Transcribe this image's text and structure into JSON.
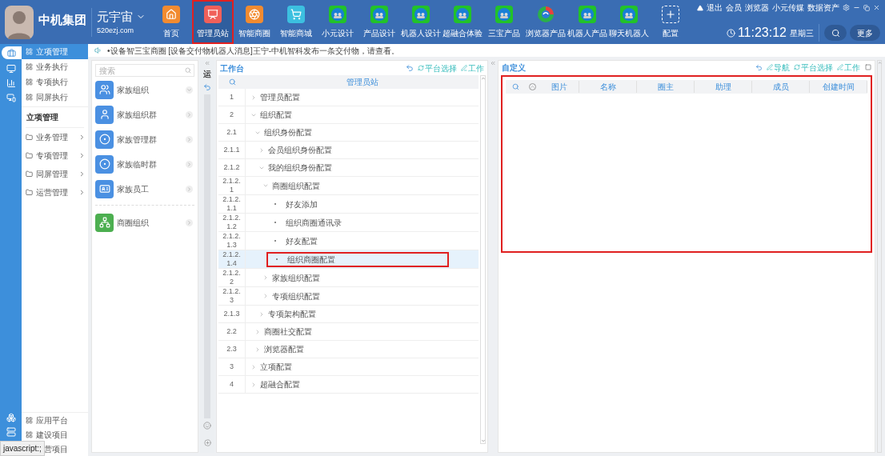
{
  "brand": {
    "name": "中机集团",
    "product": "元宇宙",
    "domain": "520ezj.com"
  },
  "nav": [
    {
      "label": "首页",
      "kind": "home",
      "selected": false
    },
    {
      "label": "管理员站",
      "kind": "admin",
      "selected": true
    },
    {
      "label": "智能商圈",
      "kind": "aperture",
      "selected": false
    },
    {
      "label": "智能商城",
      "kind": "cart",
      "selected": false
    },
    {
      "label": "小元设计",
      "kind": "globe",
      "selected": false
    },
    {
      "label": "产品设计",
      "kind": "globe",
      "selected": false
    },
    {
      "label": "机器人设计",
      "kind": "globe",
      "selected": false
    },
    {
      "label": "超融合体验",
      "kind": "globe",
      "selected": false
    },
    {
      "label": "三宝产品",
      "kind": "globe",
      "selected": false
    },
    {
      "label": "浏览器产品",
      "kind": "swirl",
      "selected": false
    },
    {
      "label": "机器人产品",
      "kind": "globe",
      "selected": false
    },
    {
      "label": "聊天机器人",
      "kind": "globe",
      "selected": false
    },
    {
      "label": "配置",
      "kind": "plus",
      "selected": false
    }
  ],
  "top_links": [
    "退出",
    "会员",
    "浏览器",
    "小元传媒",
    "数据资产"
  ],
  "clock": {
    "time": "11:23:12",
    "weekday": "星期三"
  },
  "more_button": "更多",
  "notice": "•设备智三宝商圈 [设备交付物机器人消息]王宁-中机智科发布一条交付物，请查看。",
  "sidebar": {
    "top_items": [
      {
        "label": "立项管理",
        "selected": true
      },
      {
        "label": "业务执行",
        "selected": false
      },
      {
        "label": "专项执行",
        "selected": false
      },
      {
        "label": "同屏执行",
        "selected": false
      }
    ],
    "heading": "立项管理",
    "groups": [
      "业务管理",
      "专项管理",
      "同屏管理",
      "运营管理"
    ],
    "bottom_items": [
      {
        "label": "应用平台",
        "covered": false
      },
      {
        "label": "建设项目",
        "covered": false
      },
      {
        "label": "营项目",
        "covered": true
      }
    ]
  },
  "org_list": {
    "search_placeholder": "搜索",
    "items": [
      {
        "label": "家族组织",
        "color": "#4a90e2",
        "expanded": true,
        "kind": "group"
      },
      {
        "label": "家族组织群",
        "color": "#4a90e2",
        "expanded": false,
        "kind": "user"
      },
      {
        "label": "家族管理群",
        "color": "#4a90e2",
        "expanded": false,
        "kind": "ring"
      },
      {
        "label": "家族临时群",
        "color": "#4a90e2",
        "expanded": false,
        "kind": "ring"
      },
      {
        "label": "家族员工",
        "color": "#4a90e2",
        "expanded": false,
        "kind": "badge"
      },
      {
        "label": "商圈组织",
        "color": "#4caf50",
        "expanded": false,
        "kind": "tree"
      }
    ]
  },
  "side_tab": "运",
  "workbench": {
    "title": "工作台",
    "actions": [
      "平台选择",
      "工作"
    ],
    "column": "管理员站",
    "tree": [
      {
        "number": "1",
        "label": "管理员配置",
        "kind": "branch",
        "expanded": false,
        "selected": false
      },
      {
        "number": "2",
        "label": "组织配置",
        "kind": "branch",
        "expanded": true,
        "selected": false,
        "children": [
          {
            "number": "2.1",
            "label": "组织身份配置",
            "kind": "branch",
            "expanded": true,
            "selected": false,
            "children": [
              {
                "number": "2.1.1",
                "label": "会员组织身份配置",
                "kind": "branch",
                "expanded": false,
                "selected": false
              },
              {
                "number": "2.1.2",
                "label": "我的组织身份配置",
                "kind": "branch",
                "expanded": true,
                "selected": false,
                "children": [
                  {
                    "number": "2.1.2.1",
                    "label": "商圈组织配置",
                    "kind": "branch",
                    "expanded": true,
                    "selected": false,
                    "children": [
                      {
                        "number": "2.1.2.1.1",
                        "label": "好友添加",
                        "kind": "leaf",
                        "selected": false
                      },
                      {
                        "number": "2.1.2.1.2",
                        "label": "组织商圈通讯录",
                        "kind": "leaf",
                        "selected": false
                      },
                      {
                        "number": "2.1.2.1.3",
                        "label": "好友配置",
                        "kind": "leaf",
                        "selected": false
                      },
                      {
                        "number": "2.1.2.1.4",
                        "label": "组织商圈配置",
                        "kind": "leaf",
                        "selected": true
                      }
                    ]
                  },
                  {
                    "number": "2.1.2.2",
                    "label": "家族组织配置",
                    "kind": "branch",
                    "expanded": false,
                    "selected": false
                  },
                  {
                    "number": "2.1.2.3",
                    "label": "专项组织配置",
                    "kind": "branch",
                    "expanded": false,
                    "selected": false
                  }
                ]
              },
              {
                "number": "2.1.3",
                "label": "专项架构配置",
                "kind": "branch",
                "expanded": false,
                "selected": false
              }
            ]
          },
          {
            "number": "2.2",
            "label": "商圈社交配置",
            "kind": "branch",
            "expanded": false,
            "selected": false
          },
          {
            "number": "2.3",
            "label": "浏览器配置",
            "kind": "branch",
            "expanded": false,
            "selected": false
          }
        ]
      },
      {
        "number": "3",
        "label": "立项配置",
        "kind": "branch",
        "expanded": false,
        "selected": false
      },
      {
        "number": "4",
        "label": "超融合配置",
        "kind": "branch",
        "expanded": false,
        "selected": false
      }
    ]
  },
  "custom": {
    "title": "自定义",
    "actions": [
      "导航",
      "平台选择",
      "工作"
    ],
    "highlighted": true,
    "columns": [
      "图片",
      "名称",
      "圈主",
      "助理",
      "成员",
      "创建时间"
    ]
  },
  "status_bar": "javascript:;"
}
